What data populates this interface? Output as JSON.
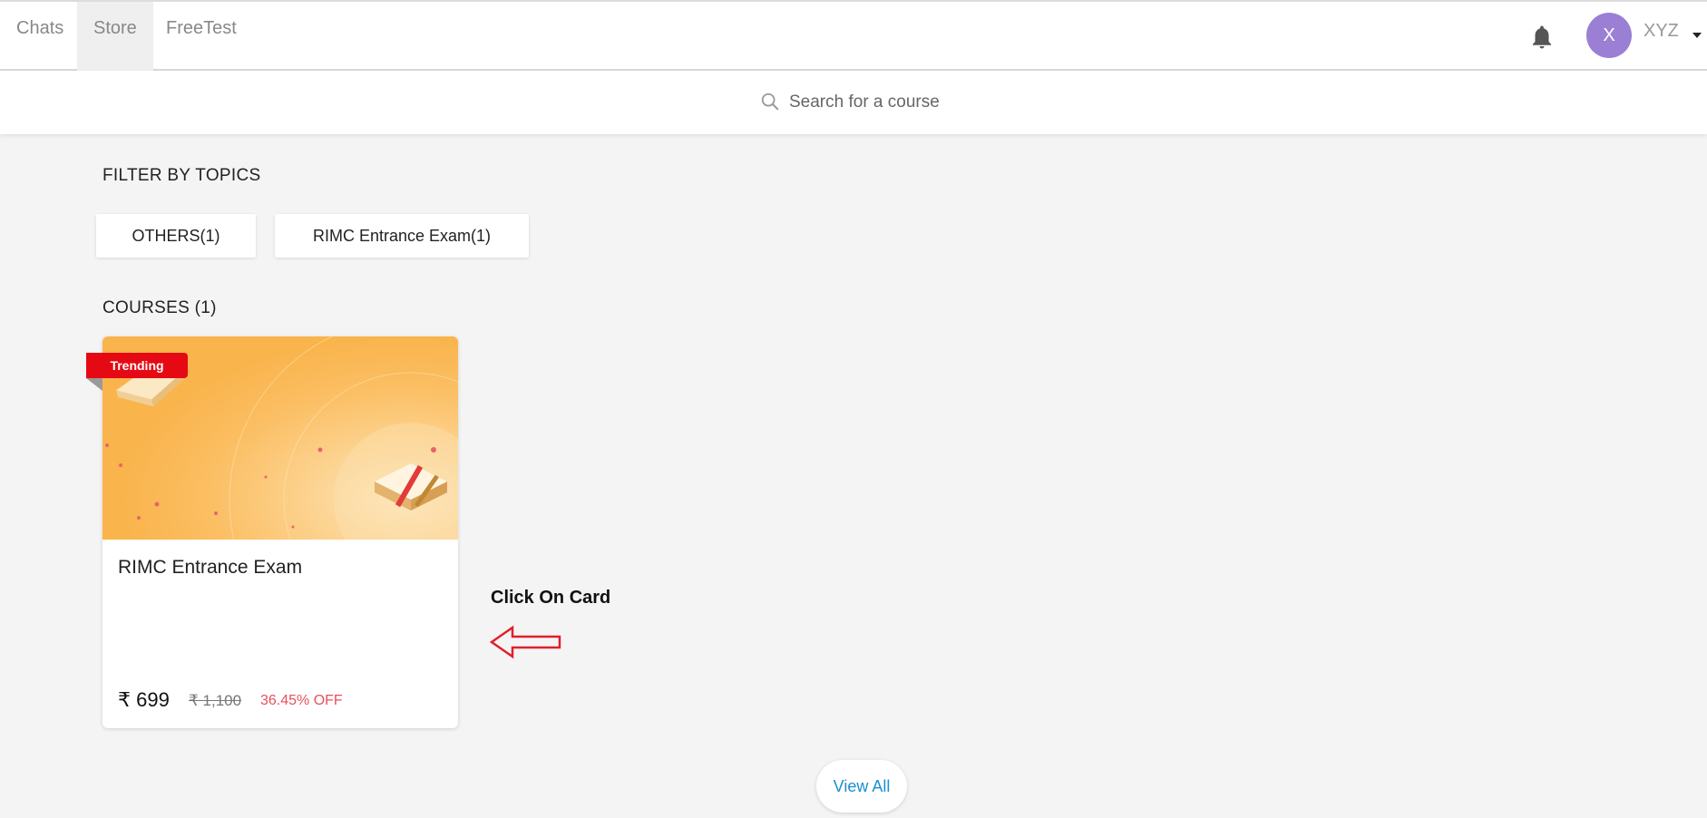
{
  "nav": {
    "tabs": [
      {
        "label": "Chats"
      },
      {
        "label": "Store"
      },
      {
        "label": "FreeTest"
      }
    ],
    "active_tab": "Store"
  },
  "user": {
    "initial": "X",
    "name": "XYZ",
    "avatar_color": "#9b7fd4"
  },
  "search": {
    "placeholder": "Search for a course"
  },
  "filters": {
    "title": "FILTER BY TOPICS",
    "chips": [
      {
        "label": "OTHERS(1)"
      },
      {
        "label": "RIMC Entrance Exam(1)"
      }
    ]
  },
  "courses": {
    "title": "COURSES (1)",
    "items": [
      {
        "badge": "Trending",
        "title": "RIMC Entrance Exam",
        "price": "₹ 699",
        "original_price": "₹ 1,100",
        "discount": "36.45% OFF"
      }
    ]
  },
  "annotation": {
    "text": "Click On Card"
  },
  "view_all_label": "View All",
  "colors": {
    "accent": "#1a8fd0",
    "badge": "#e50914",
    "discount": "#e8505b",
    "banner": "#fbb954"
  }
}
